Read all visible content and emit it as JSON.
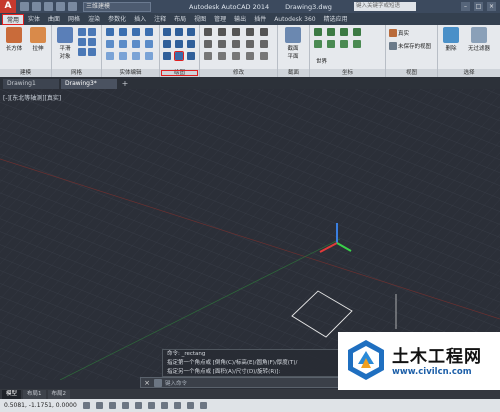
{
  "titlebar": {
    "app_button": "A",
    "workspace": "三维建模",
    "app_title": "Autodesk AutoCAD 2014",
    "doc_title": "Drawing3.dwg",
    "search_placeholder": "键入关键字或短语",
    "minimize": "–",
    "maximize": "□",
    "close": "×"
  },
  "tabs": [
    "常用",
    "实体",
    "曲面",
    "网格",
    "渲染",
    "参数化",
    "插入",
    "注释",
    "布局",
    "视图",
    "管理",
    "输出",
    "插件",
    "Autodesk 360",
    "精选应用"
  ],
  "ribbon": {
    "modeling_big1": "长方体",
    "modeling_big2": "拉伸",
    "mesh_big": "平滑\n对象",
    "section_big": "截面\n平面",
    "material_label": "真实",
    "saved_view_label": "未保存的视图",
    "world_label": "世界",
    "delete_label": "删除",
    "no_filter_label": "无过滤器",
    "panels": [
      "建模",
      "网格",
      "实体编辑",
      "绘图",
      "修改",
      "截面",
      "坐标",
      "视图",
      "选择"
    ]
  },
  "doc_tabs": {
    "tab1": "Drawing1",
    "tab2": "Drawing3*",
    "add": "+"
  },
  "viewport": {
    "label": "[-][东北等轴测][真实]"
  },
  "command": {
    "lines": [
      "命令: _rectang",
      "指定第一个角点或 [倒角(C)/标高(E)/圆角(F)/厚度(T)/",
      "指定另一个角点或 [面积(A)/尺寸(D)/旋转(R)]:"
    ],
    "close": "×",
    "prompt": "键入命令"
  },
  "layout_tabs": [
    "模型",
    "布局1",
    "布局2"
  ],
  "status": {
    "coords": "0.5081, -1.1751, 0.0000"
  },
  "watermark": {
    "title": "土木工程网",
    "url": "www.civilcn.com"
  }
}
